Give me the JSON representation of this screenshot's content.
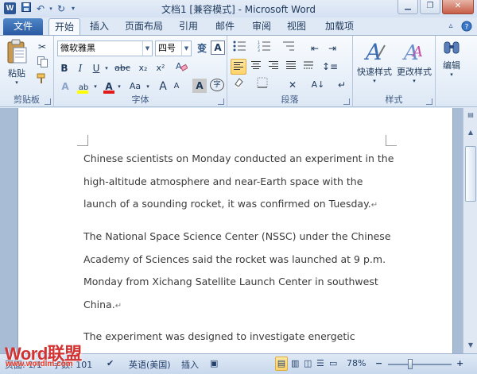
{
  "window": {
    "title": "文档1 [兼容模式] - Microsoft Word",
    "app_icon": "W"
  },
  "tabs": {
    "file": "文件",
    "items": [
      "开始",
      "插入",
      "页面布局",
      "引用",
      "邮件",
      "审阅",
      "视图",
      "加载项"
    ],
    "active": "开始"
  },
  "ribbon": {
    "clipboard": {
      "paste_label": "粘贴",
      "group_label": "剪贴板"
    },
    "font": {
      "font_name": "微软雅黑",
      "font_size": "四号",
      "wen_glyph": "变",
      "A_glyph": "A",
      "bold": "B",
      "italic": "I",
      "underline": "U",
      "strike": "abc",
      "subscript": "x₂",
      "superscript": "x²",
      "highlight": "ab",
      "font_color": "A",
      "change_case": "Aa",
      "grow": "A",
      "shrink": "A",
      "char_shade": "A",
      "enclose": "字",
      "group_label": "字体"
    },
    "paragraph": {
      "group_label": "段落"
    },
    "styles": {
      "quick_styles": "快速样式",
      "change_styles": "更改样式",
      "group_label": "样式"
    },
    "editing": {
      "label": "编辑"
    }
  },
  "document": {
    "paragraphs": [
      "Chinese scientists on Monday conducted an experiment in the high-altitude atmosphere and near-Earth space with the launch of a sounding rocket, it was confirmed on Tuesday.",
      "The National Space Science Center (NSSC) under the Chinese Academy of Sciences said the rocket was launched at 9 p.m. Monday from Xichang Satellite Launch Center in southwest China.",
      "The experiment was designed to investigate energetic"
    ],
    "para_mark": "↵"
  },
  "status": {
    "page": "页面: 1/1",
    "words": "字数: 101",
    "language": "英语(美国)",
    "insert_mode": "插入",
    "zoom": "78%",
    "zoom_minus": "−",
    "zoom_plus": "+"
  },
  "watermark": {
    "brand": "Word联盟",
    "url": "www.wordlm.com"
  },
  "colors": {
    "highlight": "#ffff00",
    "font_color": "#e01b1b",
    "accent": "#2a5aa3"
  }
}
